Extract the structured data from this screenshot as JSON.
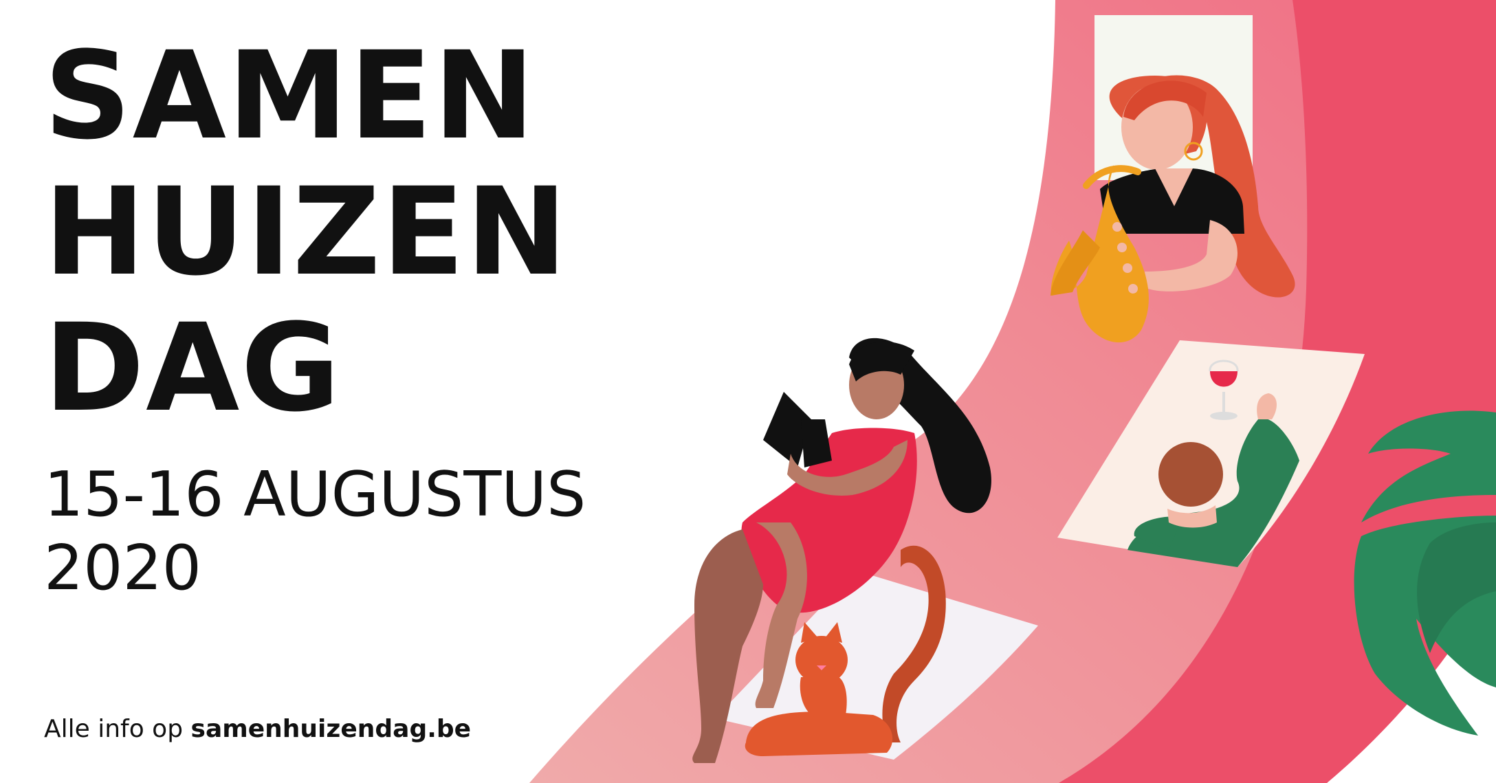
{
  "headline": {
    "line1": "SAMEN",
    "line2": "HUIZEN",
    "line3": "DAG"
  },
  "dates": {
    "line1": "15-16 AUGUSTUS",
    "line2": "2020"
  },
  "footer": {
    "prefix": "Alle info op",
    "url": "samenhuizendag.be"
  },
  "colors": {
    "text": "#111111",
    "ribbon_light": "#f0a4a7",
    "ribbon_mid": "#f07b8a",
    "ribbon_dark": "#e94d66",
    "window": "#f5f7f0",
    "mat": "#f4f1f6",
    "dress": "#e6294a",
    "skin_dark": "#b87a66",
    "skin_light": "#f3b8a6",
    "cat": "#e2582e",
    "sax": "#f0a020",
    "hair_red": "#e0563a",
    "sweater": "#2b8055",
    "leaves": "#2a8a5c"
  },
  "illustration_icons": [
    "reading-woman-icon",
    "cat-icon",
    "saxophone-player-icon",
    "wine-glass-person-icon",
    "plant-leaves-icon"
  ]
}
